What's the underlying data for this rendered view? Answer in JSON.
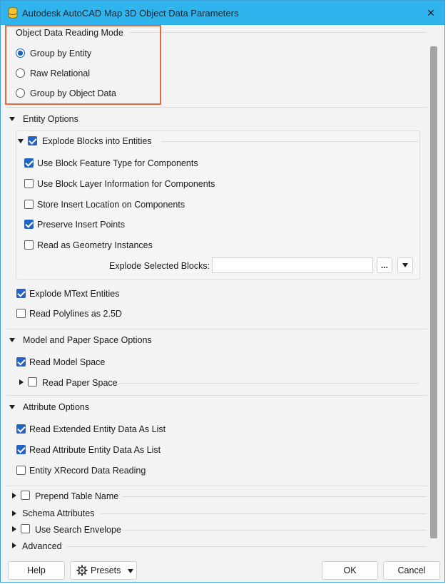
{
  "window": {
    "title": "Autodesk AutoCAD Map 3D Object Data Parameters"
  },
  "reading_mode": {
    "title": "Object Data Reading Mode",
    "options": [
      {
        "label": "Group by Entity",
        "selected": true
      },
      {
        "label": "Raw Relational",
        "selected": false
      },
      {
        "label": "Group by Object Data",
        "selected": false
      }
    ]
  },
  "entity_options": {
    "title": "Entity Options",
    "explode_blocks": {
      "label": "Explode Blocks into Entities",
      "checked": true,
      "items": [
        {
          "label": "Use Block Feature Type for Components",
          "checked": true
        },
        {
          "label": "Use Block Layer Information for Components",
          "checked": false
        },
        {
          "label": "Store Insert Location on Components",
          "checked": false
        },
        {
          "label": "Preserve Insert Points",
          "checked": true
        },
        {
          "label": "Read as Geometry Instances",
          "checked": false
        }
      ],
      "selected_blocks_label": "Explode Selected Blocks:",
      "selected_blocks_value": "",
      "browse_label": "..."
    },
    "items": [
      {
        "label": "Explode MText Entities",
        "checked": true
      },
      {
        "label": "Read Polylines as 2.5D",
        "checked": false
      }
    ]
  },
  "model_paper": {
    "title": "Model and Paper Space Options",
    "read_model_space": {
      "label": "Read Model Space",
      "checked": true
    },
    "read_paper_space": {
      "label": "Read Paper Space",
      "checked": false
    }
  },
  "attribute_options": {
    "title": "Attribute Options",
    "items": [
      {
        "label": "Read Extended Entity Data As List",
        "checked": true
      },
      {
        "label": "Read Attribute Entity Data As List",
        "checked": true
      },
      {
        "label": "Entity XRecord Data Reading",
        "checked": false
      }
    ]
  },
  "collapsed": {
    "prepend_table_name": "Prepend Table Name",
    "schema_attributes": "Schema Attributes",
    "use_search_envelope": "Use Search Envelope",
    "advanced": "Advanced"
  },
  "footer": {
    "help": "Help",
    "presets": "Presets",
    "ok": "OK",
    "cancel": "Cancel"
  },
  "colors": {
    "titlebar": "#2fb4ee",
    "accent": "#2263c6",
    "highlight": "#e06a3c"
  }
}
